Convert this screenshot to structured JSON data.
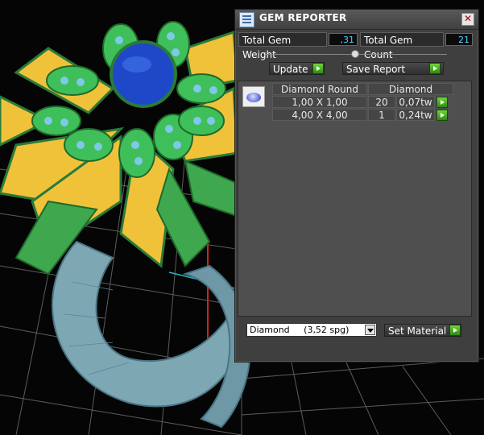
{
  "window": {
    "title": "GEM REPORTER",
    "close_symbol": "✕"
  },
  "stats": {
    "total_gem_weight_label": "Total Gem Weight",
    "total_gem_weight_value": ",31",
    "total_gem_count_label": "Total Gem Count",
    "total_gem_count_value": "21"
  },
  "actions": {
    "update_label": "Update",
    "save_report_label": "Save Report"
  },
  "gem_table": {
    "shape_header": "Diamond Round",
    "material_header": "Diamond",
    "rows": [
      {
        "size": "1,00 X 1,00",
        "count": "20",
        "weight": "0,07tw"
      },
      {
        "size": "4,00 X 4,00",
        "count": "1",
        "weight": "0,24tw"
      }
    ]
  },
  "material": {
    "selected": "Diamond     (3,52 spg)",
    "set_label": "Set Material"
  },
  "colors": {
    "accent_go": "#3fa81f",
    "value_text": "#4fd3ff",
    "panel_bg": "#3f3f3f"
  }
}
